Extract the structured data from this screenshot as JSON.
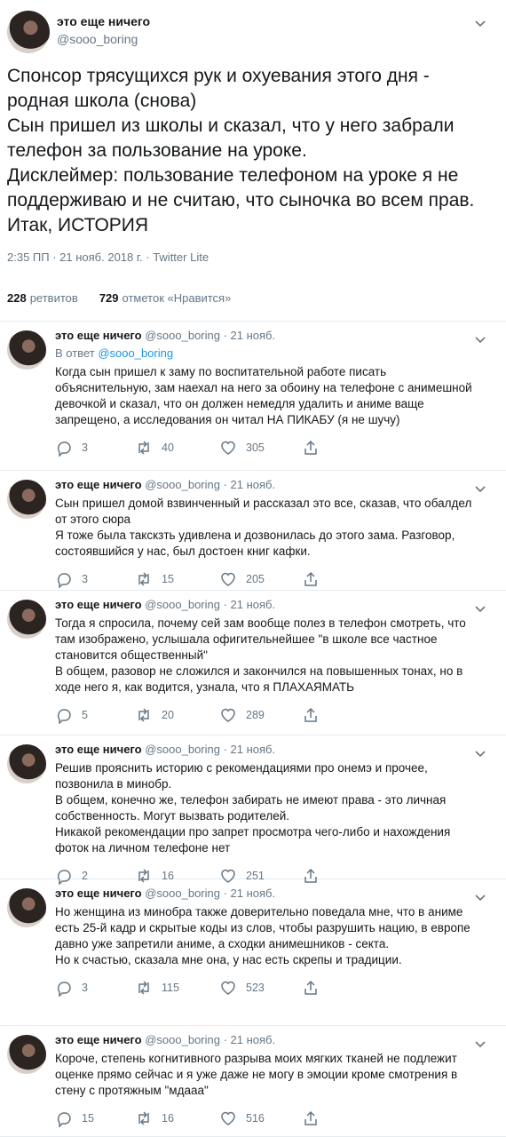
{
  "main": {
    "author_name": "это еще ничего",
    "author_handle": "@sooo_boring",
    "text_lines": [
      "Спонсор трясущихся рук и охуевания этого дня -",
      "родная школа (снова)",
      "Сын пришел из школы и сказал, что у него забрали",
      "телефон за пользование на уроке.",
      "Дисклеймер: пользование телефоном на уроке я не",
      "поддерживаю и не считаю, что сыночка во всем прав.",
      "Итак, ИСТОРИЯ"
    ],
    "meta": "2:35 ПП · 21 нояб. 2018 г. · Twitter Lite",
    "retweets_count": "228",
    "retweets_label": "ретвитов",
    "likes_count": "729",
    "likes_label": "отметок «Нравится»"
  },
  "icons": {
    "menu": "chevron-down-icon",
    "reply": "reply-icon",
    "retweet": "retweet-icon",
    "like": "heart-icon",
    "share": "share-icon"
  },
  "colors": {
    "text": "#14171a",
    "secondary": "#657786",
    "link": "#1b95e0",
    "divider": "#e6ecf0"
  },
  "replies": [
    {
      "name": "это еще ничего",
      "handle_date": "@sooo_boring · 21 нояб.",
      "in_reply_prefix": "В ответ",
      "in_reply_handle": "@sooo_boring",
      "lines": [
        "Когда сын пришел к заму по воспитательной работе писать",
        "объяснительную, зам наехал на него за обоину на телефоне с анимешной",
        "девочкой и сказал, что он должен немедля удалить и аниме ваще",
        "запрещено, а исследования он читал НА ПИКАБУ (я не шучу)"
      ],
      "replies": "3",
      "retweets": "40",
      "likes": "305"
    },
    {
      "name": "это еще ничего",
      "handle_date": "@sooo_boring · 21 нояб.",
      "lines": [
        "Сын пришел домой взвинченный и рассказал это все, сказав, что обалдел",
        "от этого сюра",
        "Я тоже была такскзть удивлена и дозвонилась до этого зама. Разговор,",
        "состоявшийся у нас, был достоен книг кафки."
      ],
      "replies": "3",
      "retweets": "15",
      "likes": "205"
    },
    {
      "name": "это еще ничего",
      "handle_date": "@sooo_boring · 21 нояб.",
      "lines": [
        "Тогда я спросила, почему сей зам вообще полез в телефон смотреть, что",
        "там изображено, услышала офигительнейшее \"в школе все частное",
        "становится общественный\"",
        "В общем, разовор не сложился и закончился на повышенных тонах, но в",
        "ходе него я, как водится, узнала, что я ПЛАХАЯМАТЬ"
      ],
      "replies": "5",
      "retweets": "20",
      "likes": "289"
    },
    {
      "name": "это еще ничего",
      "handle_date": "@sooo_boring · 21 нояб.",
      "lines": [
        "Решив прояснить историю с рекомендациями про онемэ и прочее,",
        "позвонила в минобр.",
        "В общем, конечно же, телефон забирать не имеют права - это личная",
        "собственность. Могут вызвать родителей.",
        "Никакой рекомендации про запрет просмотра чего-либо и нахождения",
        "фоток на личном телефоне нет"
      ],
      "replies": "2",
      "retweets": "16",
      "likes": "251"
    },
    {
      "name": "это еще ничего",
      "handle_date": "@sooo_boring · 21 нояб.",
      "lines": [
        "Но женщина из минобра также доверительно поведала мне, что в аниме",
        "есть 25-й кадр и скрытые коды из слов, чтобы разрушить нацию, в европе",
        "давно уже запретили аниме, а сходки анимешников - секта.",
        "Но к счастью, сказала мне она, у нас есть скрепы и традиции."
      ],
      "replies": "3",
      "retweets": "115",
      "likes": "523"
    },
    {
      "name": "это еще ничего",
      "handle_date": "@sooo_boring · 21 нояб.",
      "lines": [
        "Короче, степень когнитивного разрыва моих мягких тканей не подлежит",
        "оценке прямо сейчас и я уже даже не могу в эмоции кроме смотрения в",
        "стену с протяжным \"мдааа\""
      ],
      "replies": "15",
      "retweets": "16",
      "likes": "516"
    }
  ]
}
